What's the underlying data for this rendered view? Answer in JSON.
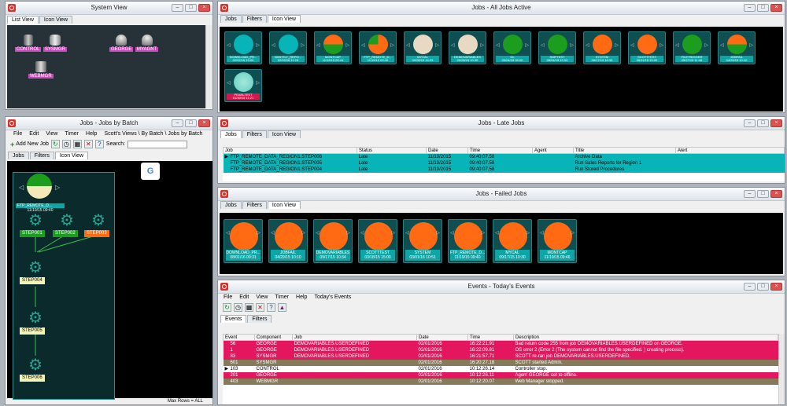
{
  "colors": {
    "cyan": "#07b4b7",
    "orange": "#ff6a13",
    "green": "#1c9d1e",
    "beige": "#e7d9c2",
    "pink": "#e4175e",
    "olive": "#867a5b"
  },
  "system_view": {
    "title": "System View",
    "tabs": [
      "List View",
      "Icon View"
    ],
    "nodes": [
      {
        "label": "CONTROL",
        "icon": "server-icon"
      },
      {
        "label": "SYSMGR",
        "icon": "database-icon"
      },
      {
        "label": "GEORGE",
        "icon": "agent-icon"
      },
      {
        "label": "MYAGNT",
        "icon": "agent-icon"
      },
      {
        "label": "WEBMGR",
        "icon": "web-icon"
      }
    ]
  },
  "all_jobs": {
    "title": "Jobs - All Jobs Active",
    "tabs": [
      "Jobs",
      "Filters",
      "Icon View"
    ],
    "tiles": [
      {
        "name": "DOWNLOAD_PR...",
        "date": "02/02/16 13:00",
        "state": "cyan"
      },
      {
        "name": "NIGHTLY_REPO...",
        "date": "02/02/16 11:15",
        "state": "cyan"
      },
      {
        "name": "MONTCAP",
        "date": "11/19/15 09:44",
        "state": "half"
      },
      {
        "name": "FTP_REMOTE_D...",
        "date": "11/19/15 09:40",
        "state": "pie"
      },
      {
        "name": "MYCAL",
        "date": "09/28/15 14:33",
        "state": "beige"
      },
      {
        "name": "DEMOVARIABLES",
        "date": "09/28/15 10:30",
        "state": "beige"
      },
      {
        "name": "GL",
        "date": "09/04/15 09:00",
        "state": "green"
      },
      {
        "name": "SMPTEST",
        "date": "08/04/15 12:00",
        "state": "green"
      },
      {
        "name": "SYSTEM",
        "date": "06/17/15 16:35",
        "state": "orange"
      },
      {
        "name": "SCOTTTEST",
        "date": "06/11/15 15:00",
        "state": "orange"
      },
      {
        "name": "FILETRIGGER",
        "date": "05/27/15 11:48",
        "state": "green"
      },
      {
        "name": "JOBFAIL",
        "date": "04/29/15 10:10",
        "state": "half"
      },
      {
        "name": "PEARLTEST",
        "date": "01/30/15 11:21",
        "state": "cyanred"
      }
    ]
  },
  "batch": {
    "title": "Jobs - Jobs by Batch",
    "menu": [
      "File",
      "Edit",
      "View",
      "Timer",
      "Help"
    ],
    "breadcrumb": "Scott's Views \\ By Batch \\ Jobs by Batch",
    "add_label": "Add New Job",
    "search_label": "Search:",
    "tabs": [
      "Jobs",
      "Filters",
      "Icon View"
    ],
    "batch_name": "FTP_REMOTE_D...",
    "batch_date": "11/19/15 09:40",
    "steps": [
      "STEP001",
      "STEP002",
      "STEP003",
      "STEP004",
      "STEP005",
      "STEP006"
    ],
    "footer": "Max Rows = ALL"
  },
  "late": {
    "title": "Jobs - Late Jobs",
    "tabs": [
      "Jobs",
      "Filters",
      "Icon View"
    ],
    "columns": [
      "Job",
      "Status",
      "Date",
      "Time",
      "Agent",
      "Title",
      "Alert"
    ],
    "rows": [
      {
        "job": "FTP_REMOTE_DATA_REGION1.STEP006",
        "status": "Late",
        "date": "11/19/2015",
        "time": "09:40:07.58",
        "agent": "",
        "title": "Archive Data",
        "alert": ""
      },
      {
        "job": "FTP_REMOTE_DATA_REGION1.STEP005",
        "status": "Late",
        "date": "11/19/2015",
        "time": "09:40:07.58",
        "agent": "",
        "title": "Run Sales Reports for Region 1",
        "alert": ""
      },
      {
        "job": "FTP_REMOTE_DATA_REGION1.STEP004",
        "status": "Late",
        "date": "11/19/2015",
        "time": "09:40:07.58",
        "agent": "",
        "title": "Run Stored Procedures",
        "alert": ""
      }
    ]
  },
  "failed": {
    "title": "Jobs - Failed Jobs",
    "tabs": [
      "Jobs",
      "Filters",
      "Icon View"
    ],
    "tiles": [
      {
        "name": "DOWNLOAD_PR...",
        "date": "08/01/16 09:31"
      },
      {
        "name": "JOBFAIL",
        "date": "04/29/15 10:10"
      },
      {
        "name": "DEMOVARIABLES",
        "date": "09/17/15 10:34"
      },
      {
        "name": "SCOTTTEST",
        "date": "03/18/15 15:00"
      },
      {
        "name": "SYSTEM",
        "date": "03/01/16 10:51"
      },
      {
        "name": "FTP_REMOTE_D...",
        "date": "11/19/15 09:40"
      },
      {
        "name": "MYCAL",
        "date": "09/17/15 10:30"
      },
      {
        "name": "MONTCAP",
        "date": "11/19/15 09:46"
      }
    ]
  },
  "events": {
    "title": "Events - Today's Events",
    "menu": [
      "File",
      "Edit",
      "View",
      "Timer",
      "Help"
    ],
    "view_label": "Today's Events",
    "tabs": [
      "Events",
      "Filters"
    ],
    "columns": [
      "Event",
      "Component",
      "Job",
      "Date",
      "Time",
      "Description"
    ],
    "rows": [
      {
        "event": "56",
        "component": "GEORGE",
        "job": "DEMOVARIABLES.USERDEFINED",
        "date": "02/01/2016",
        "time": "16:22:21.91",
        "desc": "Bad return code 255 from job DEMOVARIABLES.USERDEFINED on GEORGE.",
        "style": "pink"
      },
      {
        "event": "1",
        "component": "GEORGE",
        "job": "DEMOVARIABLES.USERDEFINED",
        "date": "02/01/2016",
        "time": "16:22:09.81",
        "desc": "OS error 2 (Error 2 (The system cannot find the file specified. ) creating process).",
        "style": "pink"
      },
      {
        "event": "83",
        "component": "SYSMGR",
        "job": "DEMOVARIABLES.USERDEFINED",
        "date": "02/01/2016",
        "time": "16:21:57.71",
        "desc": "SCOTT re-ran job DEMOVARIABLES.USERDEFINED.",
        "style": "pink"
      },
      {
        "event": "601",
        "component": "SYSMGR",
        "job": "",
        "date": "02/01/2016",
        "time": "16:20:27.18",
        "desc": "SCOTT started Admin.",
        "style": "olive"
      },
      {
        "event": "103",
        "component": "CONTROL",
        "job": "",
        "date": "02/01/2016",
        "time": "10:12:26.14",
        "desc": "Controller stop.",
        "style": "sel"
      },
      {
        "event": "201",
        "component": "GEORGE",
        "job": "",
        "date": "02/01/2016",
        "time": "10:12:26.11",
        "desc": "Agent GEORGE set to offline.",
        "style": "pink"
      },
      {
        "event": "403",
        "component": "WEBMGR",
        "job": "",
        "date": "02/01/2016",
        "time": "10:12:20.07",
        "desc": "Web Manager stopped.",
        "style": "olive"
      }
    ]
  }
}
